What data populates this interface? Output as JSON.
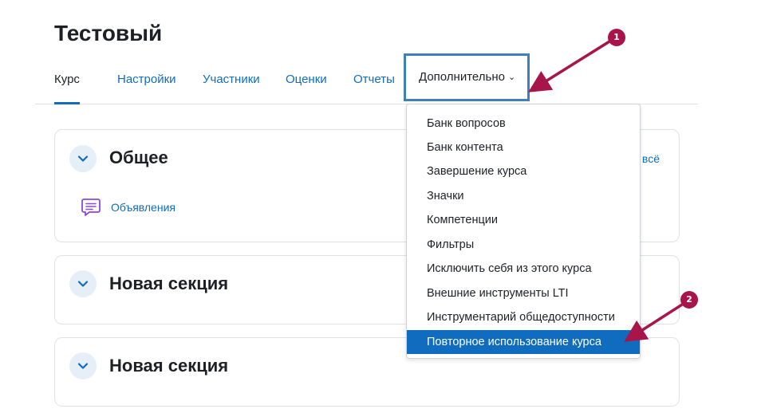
{
  "course": {
    "title": "Тестовый"
  },
  "nav": {
    "tabs": [
      {
        "label": "Курс"
      },
      {
        "label": "Настройки"
      },
      {
        "label": "Участники"
      },
      {
        "label": "Оценки"
      },
      {
        "label": "Отчеты"
      }
    ],
    "more_label": "Дополнительно",
    "more_icon": "chevron-down-icon"
  },
  "sections": [
    {
      "title": "Общее",
      "toggle_icon": "chevron-down-icon",
      "expand_label": "всё",
      "activities": [
        {
          "label": "Объявления",
          "icon": "forum-icon"
        }
      ]
    },
    {
      "title": "Новая секция",
      "toggle_icon": "chevron-down-icon"
    },
    {
      "title": "Новая секция",
      "toggle_icon": "chevron-down-icon"
    }
  ],
  "dropdown": {
    "items": [
      {
        "label": "Банк вопросов"
      },
      {
        "label": "Банк контента"
      },
      {
        "label": "Завершение курса"
      },
      {
        "label": "Значки"
      },
      {
        "label": "Компетенции"
      },
      {
        "label": "Фильтры"
      },
      {
        "label": "Исключить себя из этого курса"
      },
      {
        "label": "Внешние инструменты LTI"
      },
      {
        "label": "Инструментарий общедоступности"
      },
      {
        "label": "Повторное использование курса"
      }
    ],
    "selected_index": 9
  },
  "annotations": [
    {
      "number": "1",
      "color": "#a8154a"
    },
    {
      "number": "2",
      "color": "#a8154a"
    }
  ],
  "colors": {
    "accent": "#0f6cbf",
    "annotation": "#a8154a",
    "text": "#1d2125"
  }
}
